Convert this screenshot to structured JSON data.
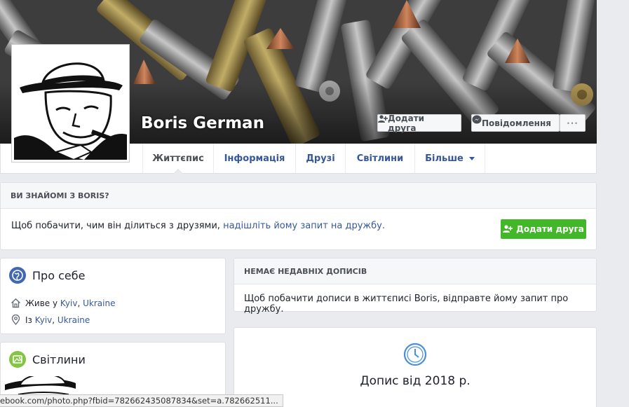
{
  "profile": {
    "name": "Boris German",
    "buttons": {
      "add_friend": "Додати друга",
      "message": "Повідомлення",
      "more": "···"
    }
  },
  "tabs": [
    {
      "label": "Життєпис",
      "active": true
    },
    {
      "label": "Інформація",
      "active": false
    },
    {
      "label": "Друзі",
      "active": false
    },
    {
      "label": "Світлини",
      "active": false
    },
    {
      "label": "Більше",
      "active": false
    }
  ],
  "know": {
    "title": "ВИ ЗНАЙОМІ З BORIS?",
    "text": "Щоб побачити, чим він ділиться з друзями, ",
    "link": "надішліть йому запит на дружбу.",
    "button": "Додати друга"
  },
  "about": {
    "title": "Про себе",
    "lives_prefix": "Живе у ",
    "lives_city": "Kyiv",
    "lives_sep": ", ",
    "lives_country": "Ukraine",
    "from_prefix": "Із ",
    "from_city": "Kyiv",
    "from_sep": ", ",
    "from_country": "Ukraine"
  },
  "photos": {
    "title": "Світлини"
  },
  "posts": {
    "no_recent_title": "НЕМАЄ НЕДАВНІХ ДОПИСІВ",
    "no_recent_text": "Щоб побачити дописи в життєписі Boris, відправте йому запит про дружбу.",
    "year_label": "Допис від 2018 р."
  },
  "status_url": "ebook.com/photo.php?fbid=782662435087834&set=a.782662511...",
  "colors": {
    "link": "#365899",
    "green": "#42b72a",
    "page_bg": "#e9ebee"
  }
}
